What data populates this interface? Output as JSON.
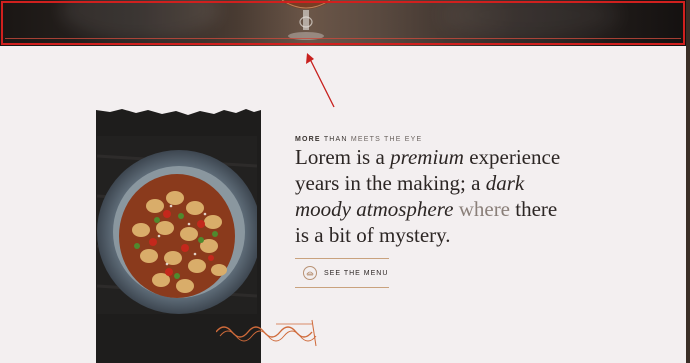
{
  "hero": {
    "accent_color": "#d0201e"
  },
  "intro": {
    "eyebrow_bold": "MORE",
    "eyebrow_rest": " THAN ",
    "eyebrow_light": "MEETS THE EYE",
    "headline": {
      "p1": "Lorem is a ",
      "p2": "premium",
      "p3": " experience years in the making; a ",
      "p4": "dark moody atmosphere",
      "p5": " where ",
      "p6": "there is a bit of mystery."
    }
  },
  "menu_button": {
    "label": "SEE THE MENU",
    "icon": "plate-icon"
  },
  "colors": {
    "background": "#f3eff0",
    "accent": "#c9a27e",
    "text": "#2c2624",
    "annotation": "#d0201e"
  }
}
